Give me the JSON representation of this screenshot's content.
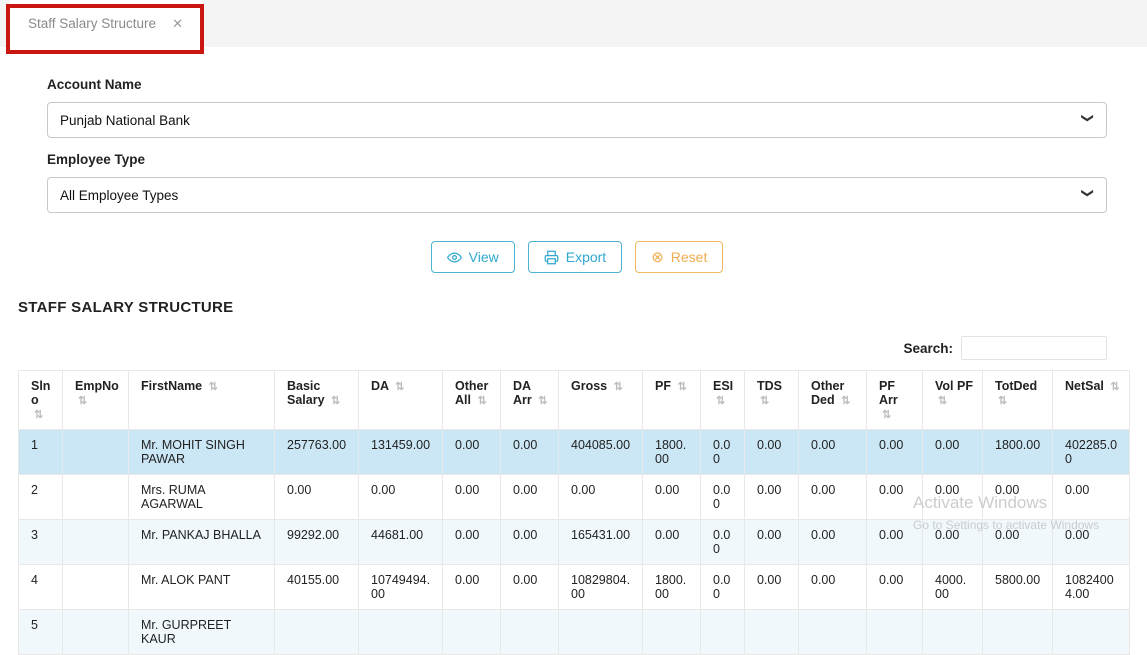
{
  "tab": {
    "title": "Staff Salary Structure",
    "close_glyph": "✕"
  },
  "form": {
    "account_name": {
      "label": "Account Name",
      "value": "Punjab National Bank"
    },
    "employee_type": {
      "label": "Employee Type",
      "value": "All Employee Types"
    }
  },
  "buttons": {
    "view_label": "View",
    "export_label": "Export",
    "reset_label": "Reset",
    "reset_glyph": "⊗"
  },
  "section_title": "STAFF SALARY STRUCTURE",
  "search": {
    "label": "Search:",
    "value": ""
  },
  "icons": {
    "sort_glyph": "⇅",
    "select_chevron_glyph": "❯"
  },
  "table": {
    "selected_row_index": 0,
    "columns": [
      "Slno",
      "EmpNo",
      "FirstName",
      "Basic Salary",
      "DA",
      "Other All",
      "DA Arr",
      "Gross",
      "PF",
      "ESI",
      "TDS",
      "Other Ded",
      "PF Arr",
      "Vol PF",
      "TotDed",
      "NetSal"
    ],
    "rows": [
      [
        "1",
        "",
        "Mr. MOHIT SINGH PAWAR",
        "257763.00",
        "131459.00",
        "0.00",
        "0.00",
        "404085.00",
        "1800.00",
        "0.00",
        "0.00",
        "0.00",
        "0.00",
        "0.00",
        "1800.00",
        "402285.00"
      ],
      [
        "2",
        "",
        "Mrs. RUMA AGARWAL",
        "0.00",
        "0.00",
        "0.00",
        "0.00",
        "0.00",
        "0.00",
        "0.00",
        "0.00",
        "0.00",
        "0.00",
        "0.00",
        "0.00",
        "0.00"
      ],
      [
        "3",
        "",
        "Mr. PANKAJ BHALLA",
        "99292.00",
        "44681.00",
        "0.00",
        "0.00",
        "165431.00",
        "0.00",
        "0.00",
        "0.00",
        "0.00",
        "0.00",
        "0.00",
        "0.00",
        "0.00"
      ],
      [
        "4",
        "",
        "Mr. ALOK PANT",
        "40155.00",
        "10749494.00",
        "0.00",
        "0.00",
        "10829804.00",
        "1800.00",
        "0.00",
        "0.00",
        "0.00",
        "0.00",
        "4000.00",
        "5800.00",
        "10824004.00"
      ],
      [
        "5",
        "",
        "Mr. GURPREET KAUR",
        "",
        "",
        "",
        "",
        "",
        "",
        "",
        "",
        "",
        "",
        "",
        "",
        ""
      ]
    ]
  },
  "watermark": {
    "line1": "Activate Windows",
    "line2": "Go to Settings to activate Windows"
  },
  "colors": {
    "accent_blue": "#31a8cf",
    "accent_orange": "#f0ad4e",
    "annotation_red": "#c9170f",
    "selected_row": "#cbe7f6",
    "stripe_row": "#f1f8fc"
  }
}
